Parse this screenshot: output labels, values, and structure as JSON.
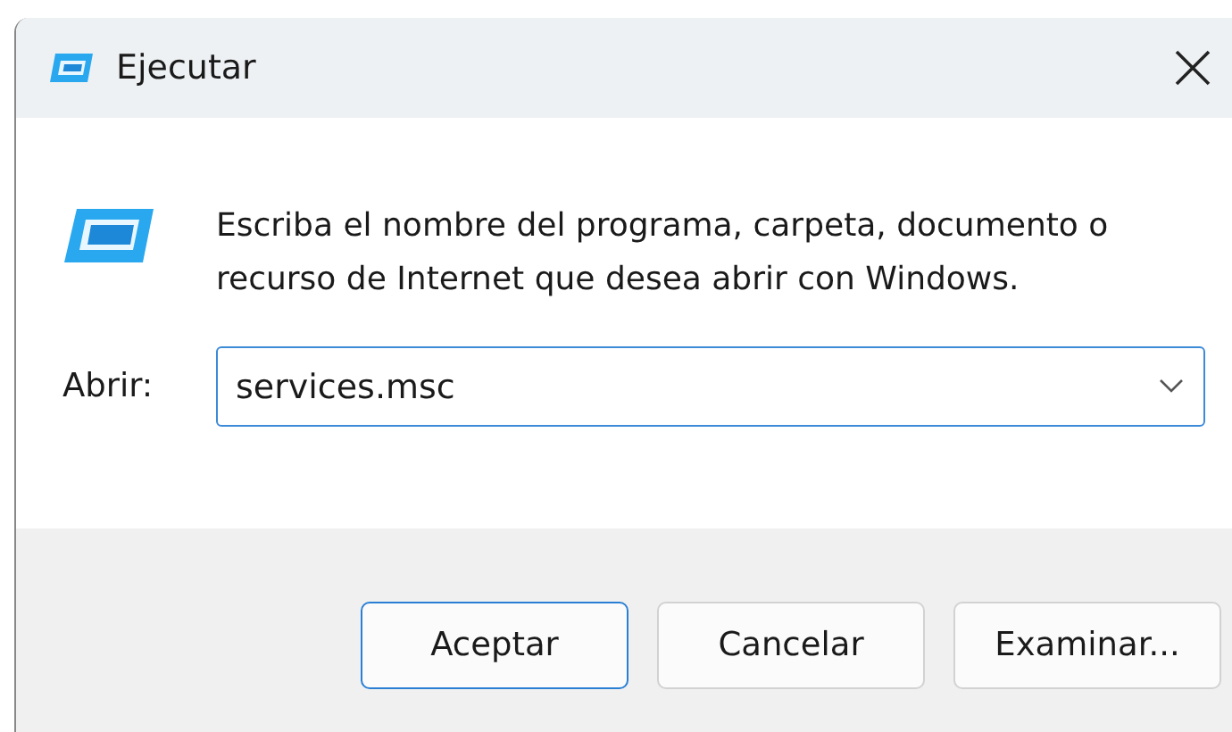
{
  "window": {
    "title": "Ejecutar"
  },
  "message": "Escriba el nombre del programa, carpeta, documento o recurso de Internet que desea abrir con Windows.",
  "open_field": {
    "label": "Abrir:",
    "value": "services.msc"
  },
  "buttons": [
    {
      "label": "Aceptar",
      "default": true
    },
    {
      "label": "Cancelar",
      "default": false
    },
    {
      "label": "Examinar...",
      "default": false
    }
  ]
}
